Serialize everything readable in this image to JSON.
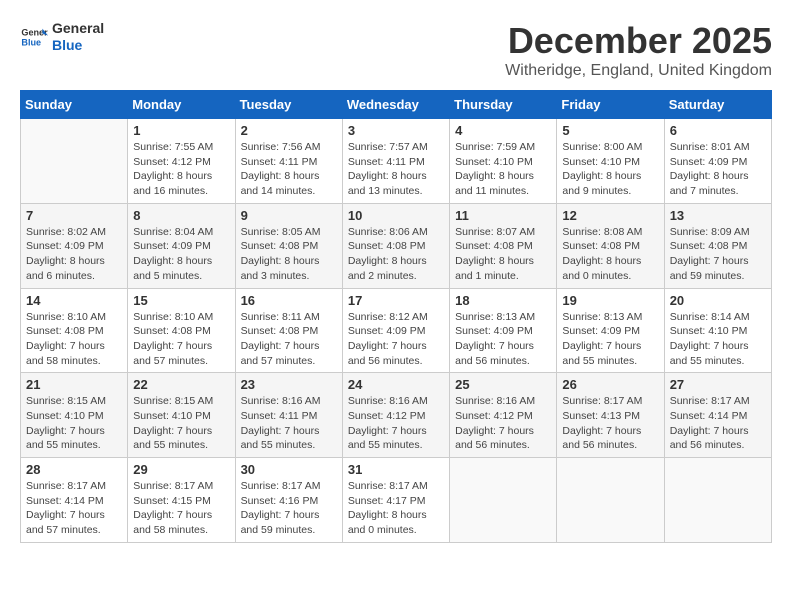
{
  "header": {
    "logo_general": "General",
    "logo_blue": "Blue",
    "month": "December 2025",
    "location": "Witheridge, England, United Kingdom"
  },
  "weekdays": [
    "Sunday",
    "Monday",
    "Tuesday",
    "Wednesday",
    "Thursday",
    "Friday",
    "Saturday"
  ],
  "weeks": [
    [
      {
        "day": "",
        "info": ""
      },
      {
        "day": "1",
        "info": "Sunrise: 7:55 AM\nSunset: 4:12 PM\nDaylight: 8 hours\nand 16 minutes."
      },
      {
        "day": "2",
        "info": "Sunrise: 7:56 AM\nSunset: 4:11 PM\nDaylight: 8 hours\nand 14 minutes."
      },
      {
        "day": "3",
        "info": "Sunrise: 7:57 AM\nSunset: 4:11 PM\nDaylight: 8 hours\nand 13 minutes."
      },
      {
        "day": "4",
        "info": "Sunrise: 7:59 AM\nSunset: 4:10 PM\nDaylight: 8 hours\nand 11 minutes."
      },
      {
        "day": "5",
        "info": "Sunrise: 8:00 AM\nSunset: 4:10 PM\nDaylight: 8 hours\nand 9 minutes."
      },
      {
        "day": "6",
        "info": "Sunrise: 8:01 AM\nSunset: 4:09 PM\nDaylight: 8 hours\nand 7 minutes."
      }
    ],
    [
      {
        "day": "7",
        "info": "Sunrise: 8:02 AM\nSunset: 4:09 PM\nDaylight: 8 hours\nand 6 minutes."
      },
      {
        "day": "8",
        "info": "Sunrise: 8:04 AM\nSunset: 4:09 PM\nDaylight: 8 hours\nand 5 minutes."
      },
      {
        "day": "9",
        "info": "Sunrise: 8:05 AM\nSunset: 4:08 PM\nDaylight: 8 hours\nand 3 minutes."
      },
      {
        "day": "10",
        "info": "Sunrise: 8:06 AM\nSunset: 4:08 PM\nDaylight: 8 hours\nand 2 minutes."
      },
      {
        "day": "11",
        "info": "Sunrise: 8:07 AM\nSunset: 4:08 PM\nDaylight: 8 hours\nand 1 minute."
      },
      {
        "day": "12",
        "info": "Sunrise: 8:08 AM\nSunset: 4:08 PM\nDaylight: 8 hours\nand 0 minutes."
      },
      {
        "day": "13",
        "info": "Sunrise: 8:09 AM\nSunset: 4:08 PM\nDaylight: 7 hours\nand 59 minutes."
      }
    ],
    [
      {
        "day": "14",
        "info": "Sunrise: 8:10 AM\nSunset: 4:08 PM\nDaylight: 7 hours\nand 58 minutes."
      },
      {
        "day": "15",
        "info": "Sunrise: 8:10 AM\nSunset: 4:08 PM\nDaylight: 7 hours\nand 57 minutes."
      },
      {
        "day": "16",
        "info": "Sunrise: 8:11 AM\nSunset: 4:08 PM\nDaylight: 7 hours\nand 57 minutes."
      },
      {
        "day": "17",
        "info": "Sunrise: 8:12 AM\nSunset: 4:09 PM\nDaylight: 7 hours\nand 56 minutes."
      },
      {
        "day": "18",
        "info": "Sunrise: 8:13 AM\nSunset: 4:09 PM\nDaylight: 7 hours\nand 56 minutes."
      },
      {
        "day": "19",
        "info": "Sunrise: 8:13 AM\nSunset: 4:09 PM\nDaylight: 7 hours\nand 55 minutes."
      },
      {
        "day": "20",
        "info": "Sunrise: 8:14 AM\nSunset: 4:10 PM\nDaylight: 7 hours\nand 55 minutes."
      }
    ],
    [
      {
        "day": "21",
        "info": "Sunrise: 8:15 AM\nSunset: 4:10 PM\nDaylight: 7 hours\nand 55 minutes."
      },
      {
        "day": "22",
        "info": "Sunrise: 8:15 AM\nSunset: 4:10 PM\nDaylight: 7 hours\nand 55 minutes."
      },
      {
        "day": "23",
        "info": "Sunrise: 8:16 AM\nSunset: 4:11 PM\nDaylight: 7 hours\nand 55 minutes."
      },
      {
        "day": "24",
        "info": "Sunrise: 8:16 AM\nSunset: 4:12 PM\nDaylight: 7 hours\nand 55 minutes."
      },
      {
        "day": "25",
        "info": "Sunrise: 8:16 AM\nSunset: 4:12 PM\nDaylight: 7 hours\nand 56 minutes."
      },
      {
        "day": "26",
        "info": "Sunrise: 8:17 AM\nSunset: 4:13 PM\nDaylight: 7 hours\nand 56 minutes."
      },
      {
        "day": "27",
        "info": "Sunrise: 8:17 AM\nSunset: 4:14 PM\nDaylight: 7 hours\nand 56 minutes."
      }
    ],
    [
      {
        "day": "28",
        "info": "Sunrise: 8:17 AM\nSunset: 4:14 PM\nDaylight: 7 hours\nand 57 minutes."
      },
      {
        "day": "29",
        "info": "Sunrise: 8:17 AM\nSunset: 4:15 PM\nDaylight: 7 hours\nand 58 minutes."
      },
      {
        "day": "30",
        "info": "Sunrise: 8:17 AM\nSunset: 4:16 PM\nDaylight: 7 hours\nand 59 minutes."
      },
      {
        "day": "31",
        "info": "Sunrise: 8:17 AM\nSunset: 4:17 PM\nDaylight: 8 hours\nand 0 minutes."
      },
      {
        "day": "",
        "info": ""
      },
      {
        "day": "",
        "info": ""
      },
      {
        "day": "",
        "info": ""
      }
    ]
  ]
}
